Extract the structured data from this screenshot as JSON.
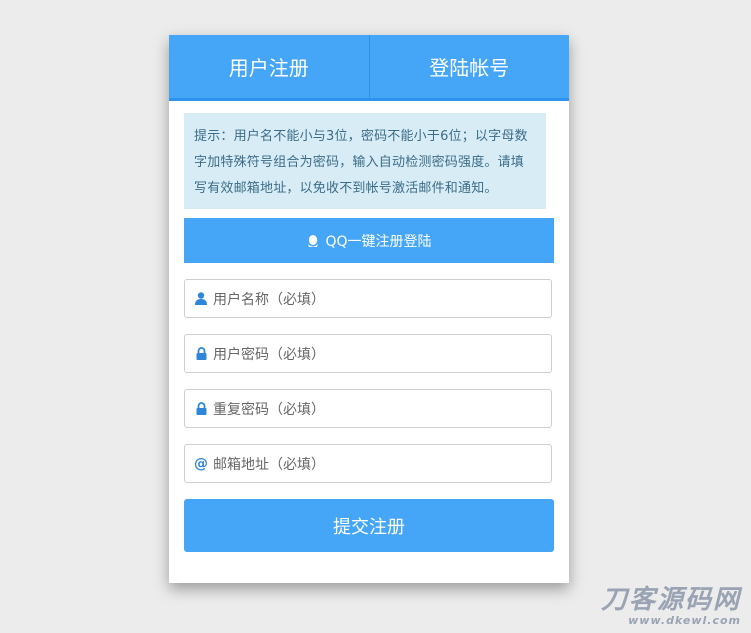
{
  "tabs": {
    "register": "用户注册",
    "login": "登陆帐号"
  },
  "notice": "提示：用户名不能小与3位，密码不能小于6位；以字母数字加特殊符号组合为密码，输入自动检测密码强度。请填写有效邮箱地址，以免收不到帐号激活邮件和通知。",
  "qq_button": "QQ一键注册登陆",
  "fields": {
    "username": "用户名称（必填）",
    "password": "用户密码（必填）",
    "repeat_password": "重复密码（必填）",
    "email": "邮箱地址（必填）"
  },
  "submit": "提交注册",
  "watermark": {
    "line1": "刀客源码网",
    "line2": "www.dkewl.com"
  },
  "colors": {
    "primary": "#45a5f7",
    "notice_bg": "#d8ecf6",
    "notice_text": "#3b6c86",
    "icon": "#2f86d9"
  }
}
